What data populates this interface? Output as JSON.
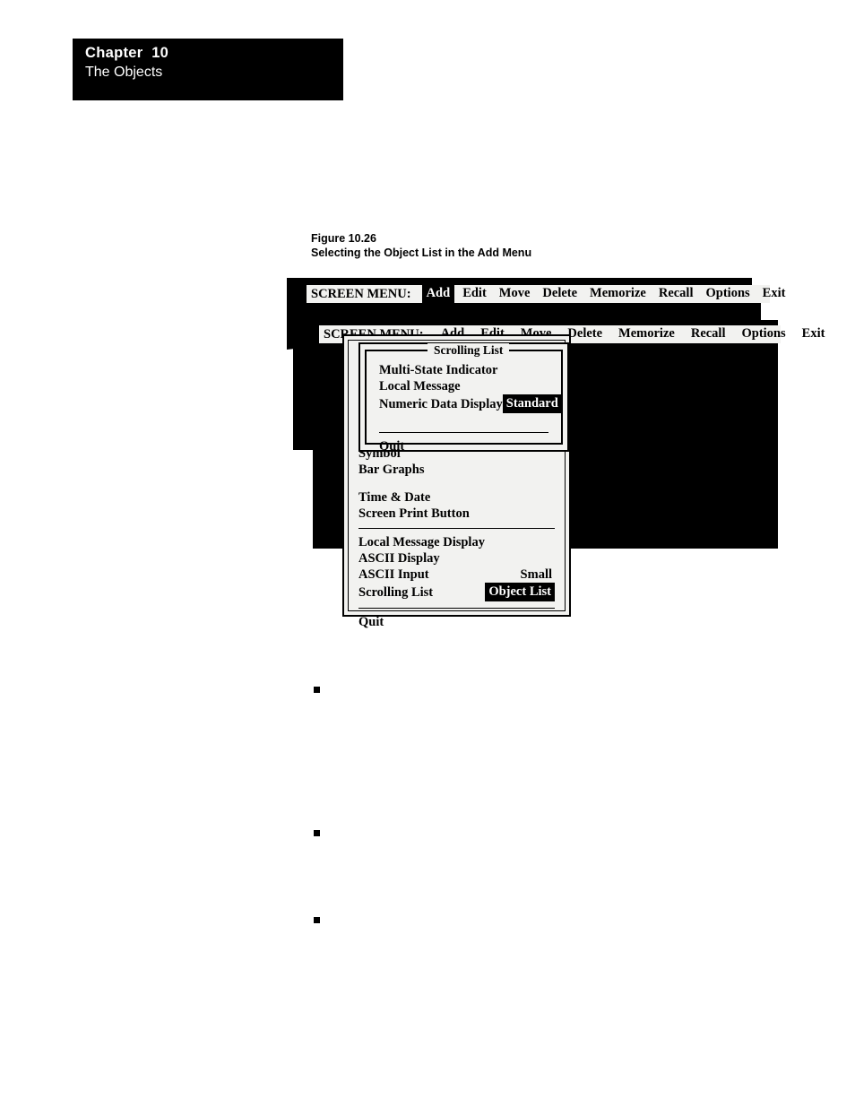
{
  "chapter": {
    "number_label": "Chapter  10",
    "subtitle": "The Objects"
  },
  "figure": {
    "number": "Figure 10.26",
    "title": "Selecting the Object List in the Add Menu"
  },
  "colors": {
    "panel_background": "#f2f2f0",
    "ink": "#000000",
    "paper": "#ffffff",
    "highlight_background": "#000000",
    "highlight_text": "#ffffff"
  },
  "menubar_top": {
    "title": "SCREEN MENU:",
    "items": [
      {
        "label": "Add",
        "selected": true
      },
      {
        "label": "Edit",
        "selected": false
      },
      {
        "label": "Move",
        "selected": false
      },
      {
        "label": "Delete",
        "selected": false
      },
      {
        "label": "Memorize",
        "selected": false
      },
      {
        "label": "Recall",
        "selected": false
      },
      {
        "label": "Options",
        "selected": false
      },
      {
        "label": "Exit",
        "selected": false
      }
    ]
  },
  "menubar_second": {
    "title": "SCREEN MENU:",
    "items": [
      {
        "label": "Add",
        "selected": false
      },
      {
        "label": "Edit",
        "selected": false
      },
      {
        "label": "Move",
        "selected": false
      },
      {
        "label": "Delete",
        "selected": false
      },
      {
        "label": "Memorize",
        "selected": false
      },
      {
        "label": "Recall",
        "selected": false
      },
      {
        "label": "Options",
        "selected": false
      },
      {
        "label": "Exit",
        "selected": false
      }
    ]
  },
  "scrolling_list_dialog": {
    "legend": "Scrolling List",
    "rows": [
      {
        "label": "Multi-State Indicator",
        "value": "",
        "highlight": false
      },
      {
        "label": "Local Message",
        "value": "",
        "highlight": false
      },
      {
        "label": "Numeric Data Display",
        "value": "Standard",
        "highlight": true
      }
    ],
    "quit_label": "Quit"
  },
  "add_menu": {
    "group_one": [
      {
        "label": "Symbol",
        "value": "",
        "highlight": false
      },
      {
        "label": "Bar Graphs",
        "value": "",
        "highlight": false
      }
    ],
    "group_two": [
      {
        "label": "Time & Date",
        "value": "",
        "highlight": false
      },
      {
        "label": "Screen Print Button",
        "value": "",
        "highlight": false
      }
    ],
    "group_three": [
      {
        "label": "Local Message Display",
        "value": "",
        "highlight": false
      },
      {
        "label": "ASCII Display",
        "value": "",
        "highlight": false
      },
      {
        "label": "ASCII Input",
        "value": "Small",
        "highlight": false
      },
      {
        "label": "Scrolling List",
        "value": "Object List",
        "highlight": true
      }
    ],
    "quit_label": "Quit"
  },
  "body_bullets": [
    {
      "name": "bullet-1"
    },
    {
      "name": "bullet-2"
    },
    {
      "name": "bullet-3"
    }
  ]
}
